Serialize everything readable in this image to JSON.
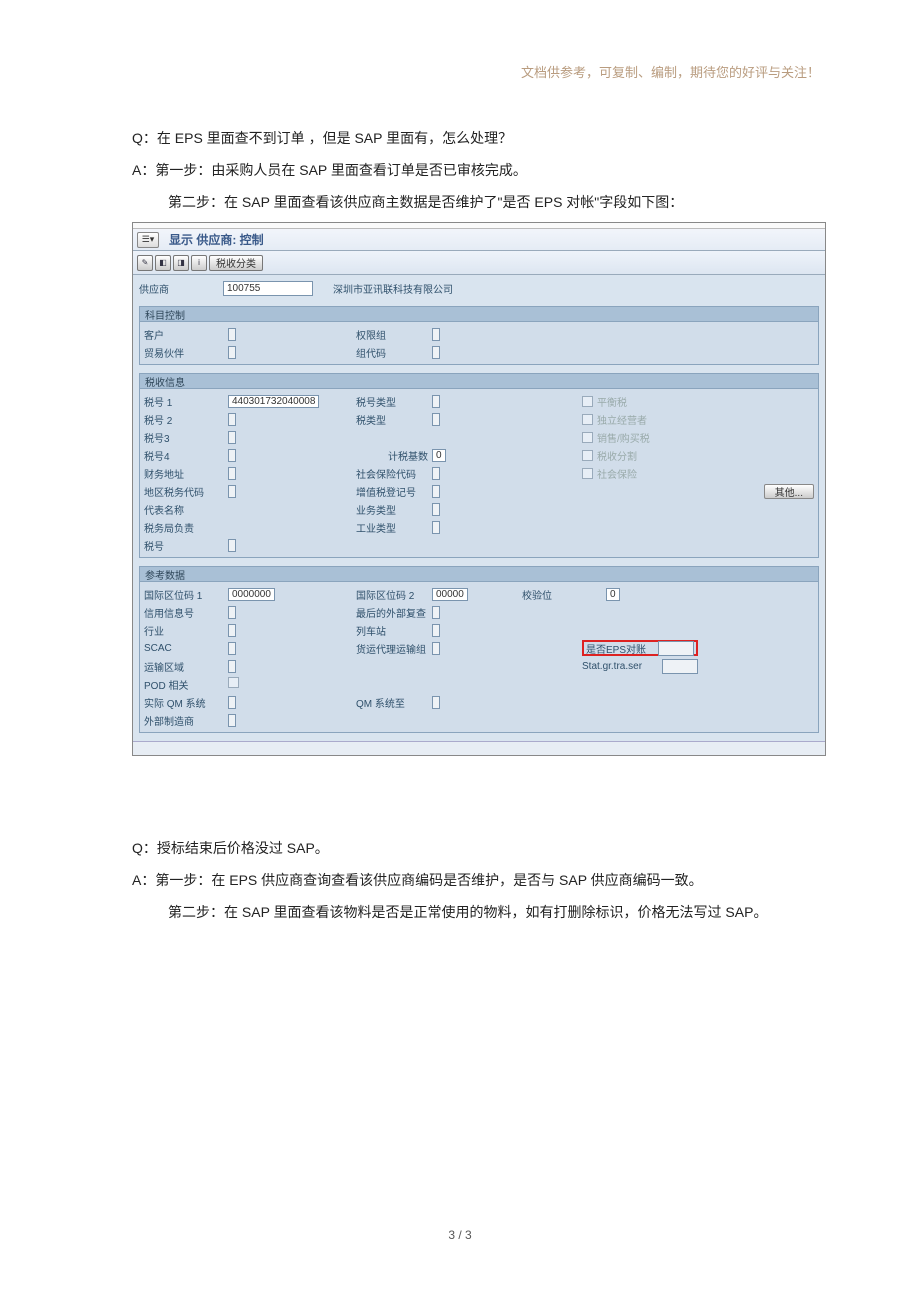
{
  "header_note": "文档供参考，可复制、编制，期待您的好评与关注！",
  "qa1": {
    "q": "Q：在 EPS 里面查不到订单 ，但是 SAP 里面有，怎么处理？",
    "a1": "A：第一步：由采购人员在 SAP 里面查看订单是否已审核完成。",
    "a2": "第二步：在 SAP 里面查看该供应商主数据是否维护了\"是否 EPS 对帐\"字段如下图："
  },
  "sap": {
    "title": "显示 供应商: 控制",
    "toolbar_btn": "税收分类",
    "vendor_label": "供应商",
    "vendor_code": "100755",
    "vendor_name": "深圳市亚讯联科技有限公司",
    "sections": {
      "acct": {
        "title": "科目控制",
        "customer": "客户",
        "auth_grp": "权限组",
        "partner": "贸易伙伴",
        "grp_code": "组代码"
      },
      "tax": {
        "title": "税收信息",
        "tax1": "税号 1",
        "tax1_val": "440301732040008",
        "tax_type": "税号类型",
        "tax2": "税号 2",
        "tax2_type": "税类型",
        "tax3": "税号3",
        "tax4": "税号4",
        "tax_base": "计税基数",
        "tax_base_val": "0",
        "addr": "财务地址",
        "soc_ins": "社会保险代码",
        "loc_tax": "地区税务代码",
        "vat_reg": "增值税登记号",
        "other_btn": "其他...",
        "rep": "代表名称",
        "biz_type": "业务类型",
        "tax_office": "税务局负责",
        "ind_type": "工业类型",
        "tax_no": "税号",
        "cb1": "平衡税",
        "cb2": "独立经营者",
        "cb3": "销售/购买税",
        "cb4": "税收分割",
        "cb5": "社会保险"
      },
      "ref": {
        "title": "参考数据",
        "intl1": "国际区位码 1",
        "intl1_val": "0000000",
        "intl2": "国际区位码 2",
        "intl2_val": "00000",
        "checkdigit": "校验位",
        "checkdigit_val": "0",
        "credit": "信用信息号",
        "ext_rev": "最后的外部复查",
        "industry": "行业",
        "station": "列车站",
        "scac": "SCAC",
        "fwd_grp": "货运代理运输组",
        "eps_flag": "是否EPS对账",
        "trans_zone": "运输区域",
        "stat": "Stat.gr.tra.ser",
        "pod": "POD 相关",
        "actual_qm": "实际 QM 系统",
        "qm_to": "QM 系统至",
        "ext_mfr": "外部制造商"
      }
    }
  },
  "qa2": {
    "q": "Q：授标结束后价格没过 SAP。",
    "a1": "A：第一步：在 EPS 供应商查询查看该供应商编码是否维护，是否与 SAP 供应商编码一致。",
    "a2": "第二步：在 SAP 里面查看该物料是否是正常使用的物料，如有打删除标识，价格无法写过 SAP。"
  },
  "page_num": "3 / 3"
}
